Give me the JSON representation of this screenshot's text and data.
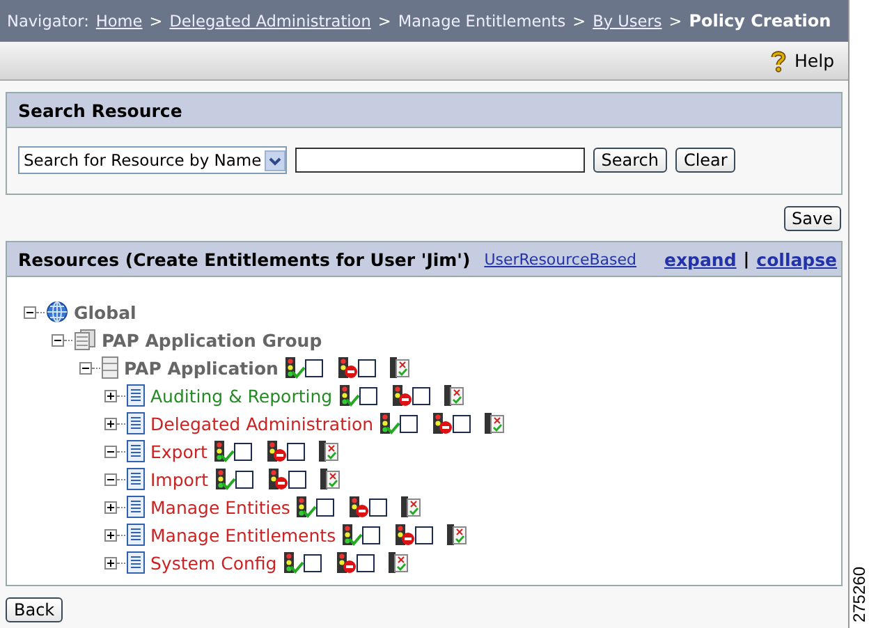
{
  "navigator": {
    "label": "Navigator:",
    "crumbs": [
      {
        "text": "Home",
        "link": true
      },
      {
        "text": "Delegated Administration",
        "link": true
      },
      {
        "text": "Manage Entitlements",
        "link": false
      },
      {
        "text": "By Users",
        "link": true
      }
    ],
    "separator": ">",
    "current": "Policy Creation"
  },
  "toolbar": {
    "help": "Help"
  },
  "search_panel": {
    "title": "Search Resource",
    "select": "Search for Resource by Name",
    "buttons": [
      "Search",
      "Clear"
    ]
  },
  "save_button": "Save",
  "resources_panel": {
    "title": "Resources (Create Entitlements for User 'Jim')",
    "mode_link": "UserResourceBased",
    "expand": "expand",
    "divider": "|",
    "collapse": "collapse",
    "tree": [
      {
        "label": "Global",
        "kind": "globe",
        "expanded": true,
        "children": [
          {
            "label": "PAP Application Group",
            "kind": "group",
            "expanded": true,
            "children": [
              {
                "label": "PAP Application",
                "kind": "application",
                "expanded": true,
                "allow_checked": false,
                "deny_checked": false,
                "children": [
                  {
                    "label": "Auditing & Reporting",
                    "kind": "resource",
                    "expanded": false,
                    "color": "#228b22",
                    "allow_checked": false,
                    "deny_checked": false
                  },
                  {
                    "label": "Delegated Administration",
                    "kind": "resource",
                    "expanded": false,
                    "color": "#cc2222",
                    "allow_checked": false,
                    "deny_checked": false
                  },
                  {
                    "label": "Export",
                    "kind": "resource",
                    "expanded": true,
                    "color": "#cc2222",
                    "allow_checked": false,
                    "deny_checked": false
                  },
                  {
                    "label": "Import",
                    "kind": "resource",
                    "expanded": true,
                    "color": "#cc2222",
                    "allow_checked": false,
                    "deny_checked": false
                  },
                  {
                    "label": "Manage Entities",
                    "kind": "resource",
                    "expanded": false,
                    "color": "#cc2222",
                    "allow_checked": false,
                    "deny_checked": false
                  },
                  {
                    "label": "Manage Entitlements",
                    "kind": "resource",
                    "expanded": false,
                    "color": "#cc2222",
                    "allow_checked": false,
                    "deny_checked": false
                  },
                  {
                    "label": "System Config",
                    "kind": "resource",
                    "expanded": false,
                    "color": "#cc2222",
                    "allow_checked": false,
                    "deny_checked": false
                  }
                ]
              }
            ]
          }
        ]
      }
    ]
  },
  "back_button": "Back",
  "figure_number": "275260"
}
